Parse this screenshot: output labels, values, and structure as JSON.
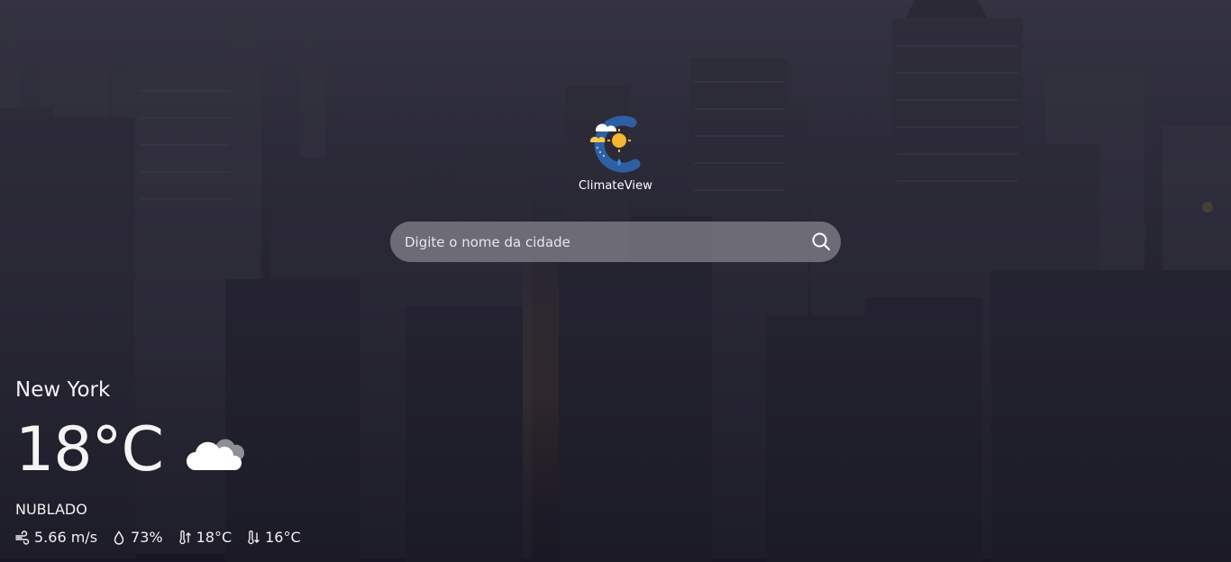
{
  "app": {
    "name": "ClimateView"
  },
  "search": {
    "placeholder": "Digite o nome da cidade",
    "value": ""
  },
  "weather": {
    "city": "New York",
    "temperature": "18°C",
    "condition": "NUBLADO",
    "condition_icon": "cloudy-icon",
    "stats": {
      "wind": "5.66 m/s",
      "humidity": "73%",
      "temp_max": "18°C",
      "temp_min": "16°C"
    }
  },
  "icons": {
    "search": "search-icon",
    "wind": "wind-icon",
    "humidity": "droplet-icon",
    "temp_max": "thermometer-up-icon",
    "temp_min": "thermometer-down-icon"
  },
  "colors": {
    "logo_ring": "#2e5fa3",
    "logo_sun": "#f5b731",
    "logo_drop": "#3d8fd8",
    "search_bg": "#96949e",
    "text": "#f2f2f2"
  }
}
